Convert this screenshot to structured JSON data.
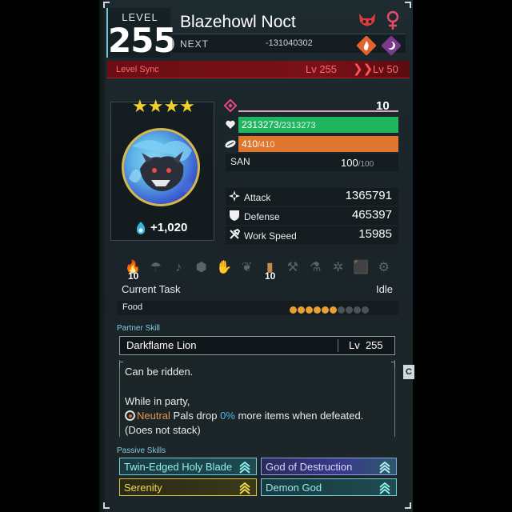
{
  "header": {
    "level_label": "LEVEL",
    "level": "255",
    "name": "Blazehowl Noct",
    "next_label": "NEXT",
    "next_value": "-131040302",
    "level_sync": {
      "label": "Level Sync",
      "from": "Lv 255",
      "arrow": "❯❯",
      "to": "Lv 50"
    },
    "icons": [
      "alpha-boss-icon",
      "female-gender-icon",
      "fire-element-icon",
      "dark-element-icon"
    ]
  },
  "portrait": {
    "stars": "★★★★",
    "trust_value": "+1,020"
  },
  "stats": {
    "rank_value": "10",
    "hp_current": "2313273",
    "hp_max": "/2313273",
    "sp_current": "410",
    "sp_max": "/410",
    "san_label": "SAN",
    "san_value": "100",
    "san_max": "/100",
    "attack_label": "Attack",
    "attack_value": "1365791",
    "defense_label": "Defense",
    "defense_value": "465397",
    "work_speed_label": "Work Speed",
    "work_speed_value": "15985"
  },
  "work": {
    "kindling_level": "10",
    "mining_level": "10",
    "current_task_label": "Current Task",
    "current_task_value": "Idle",
    "food_label": "Food",
    "food_filled": 6,
    "food_total": 10
  },
  "partner_skill": {
    "section_title": "Partner Skill",
    "name": "Darkflame Lion",
    "level": "Lv  255",
    "desc_line1": "Can be ridden.",
    "desc_line2": "While in party,",
    "desc_neutral": "Neutral",
    "desc_mid": " Pals drop ",
    "desc_percent": "0%",
    "desc_end": " more items when defeated.",
    "desc_line4": "(Does not stack)",
    "side_tab": "C"
  },
  "passive_skills": {
    "section_title": "Passive Skills",
    "items": [
      {
        "name": "Twin-Edged Holy Blade"
      },
      {
        "name": "God of Destruction"
      },
      {
        "name": "Serenity"
      },
      {
        "name": "Demon God"
      }
    ]
  },
  "colors": {
    "hp_bar": "#21b55f",
    "sp_bar": "#e0772f",
    "sync_red": "#7a1118",
    "accent_cyan": "#6fc7d8",
    "star_gold": "#f2cf2b"
  }
}
